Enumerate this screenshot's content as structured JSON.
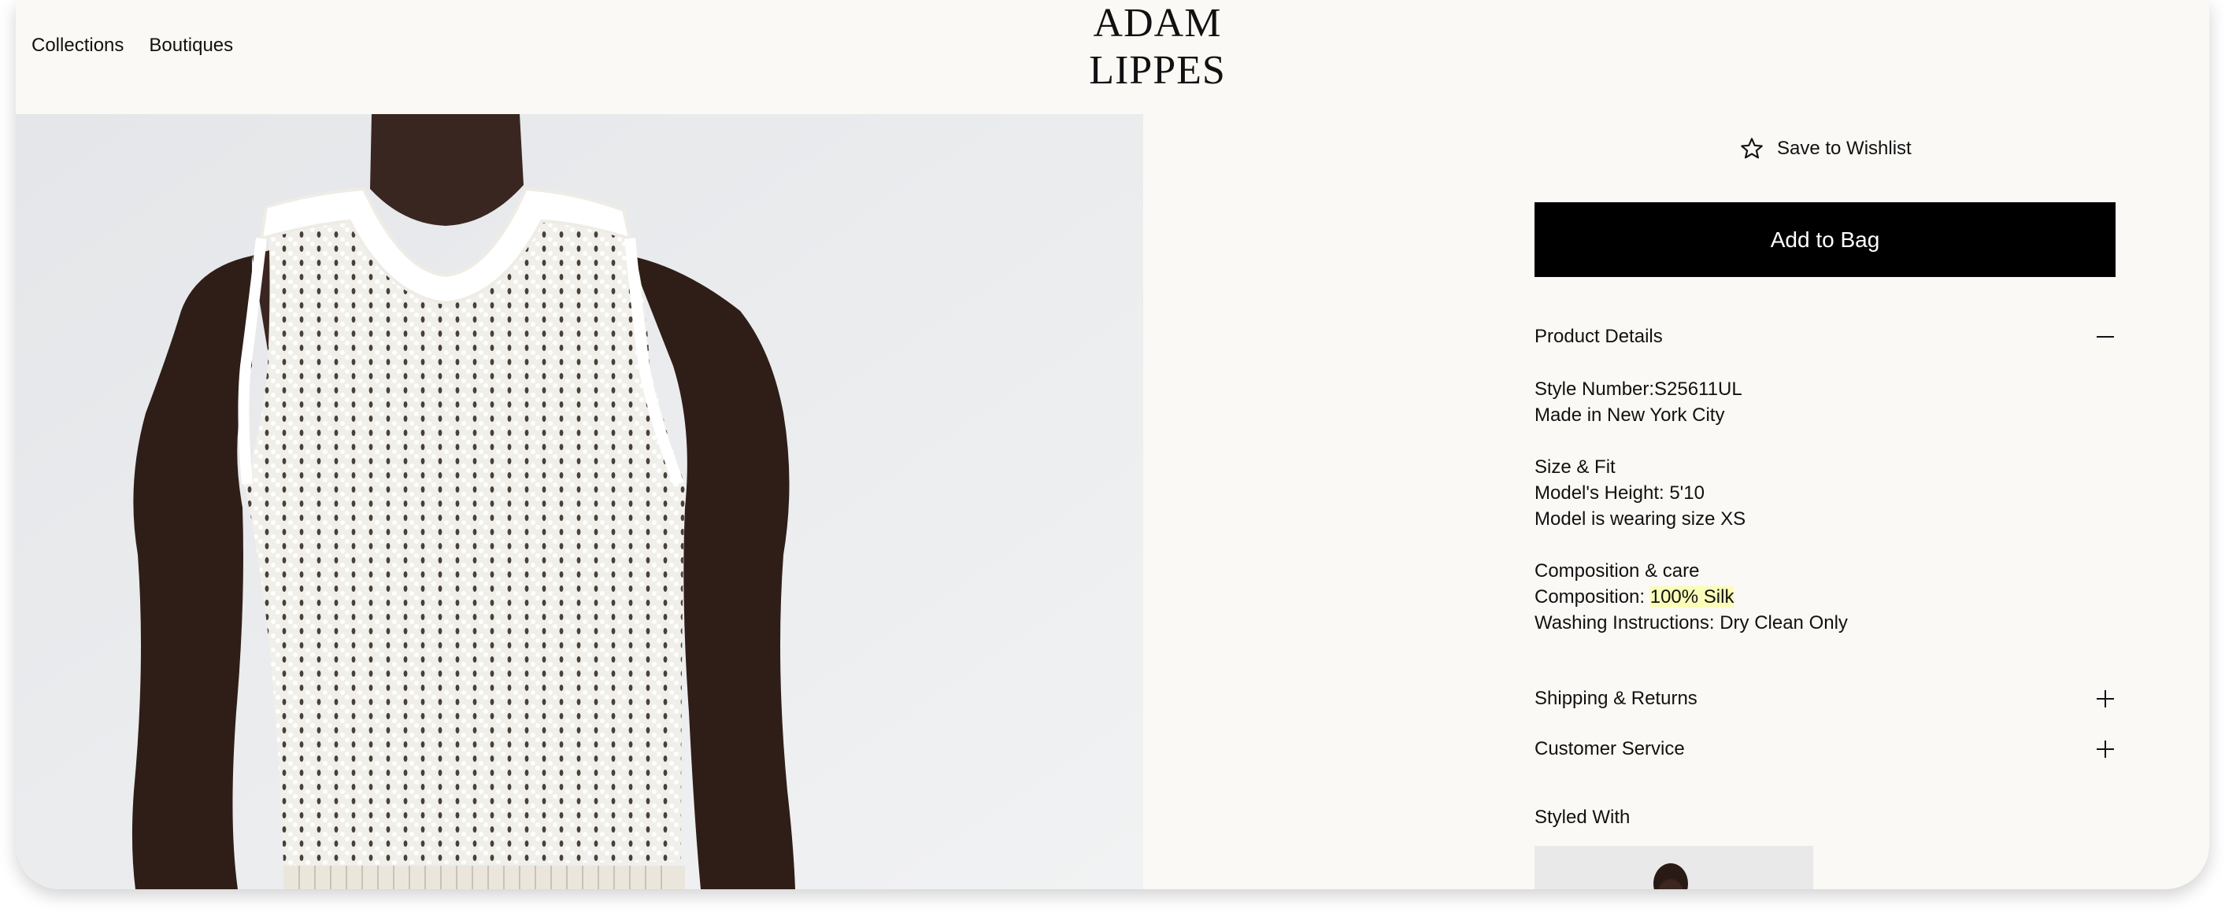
{
  "nav": {
    "collections": "Collections",
    "boutiques": "Boutiques"
  },
  "brand": {
    "line1": "ADAM",
    "line2": "LIPPES"
  },
  "actions": {
    "wishlist": "Save to Wishlist",
    "add_to_bag": "Add to Bag"
  },
  "accordion": {
    "product_details": {
      "title": "Product Details",
      "state": "expanded",
      "icon": "minus-icon"
    },
    "shipping": {
      "title": "Shipping & Returns",
      "state": "collapsed",
      "icon": "plus-icon"
    },
    "customer_service": {
      "title": "Customer Service",
      "state": "collapsed",
      "icon": "plus-icon"
    }
  },
  "details": {
    "style_number": "Style Number:S25611UL",
    "made_in": "Made in New York City",
    "size_fit_heading": "Size & Fit",
    "model_height": "Model's Height: 5'10",
    "model_size": "Model is wearing size XS",
    "composition_heading": "Composition & care",
    "composition_label": "Composition: ",
    "composition_value": "100% Silk",
    "washing": "Washing Instructions: Dry Clean Only"
  },
  "styled_with": {
    "title": "Styled With"
  },
  "colors": {
    "background": "#faf9f5",
    "button": "#000000",
    "highlight": "#fbfcb9",
    "image_bg": "#ecedee"
  }
}
